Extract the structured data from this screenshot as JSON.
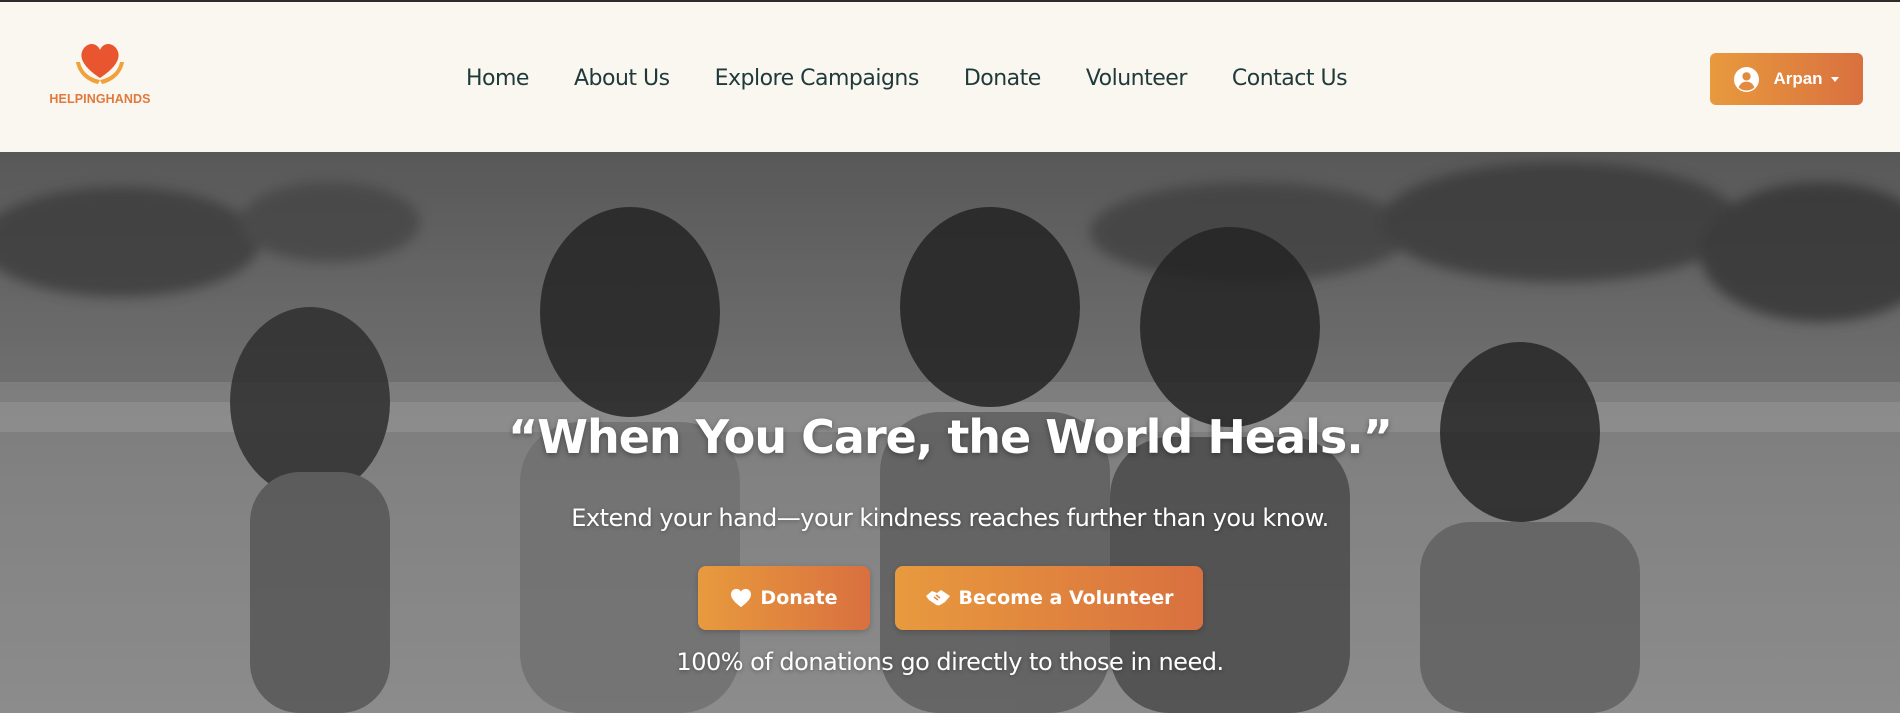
{
  "brand": {
    "name": "HELPINGHANDS",
    "logo_icon": "heart-hands-icon",
    "color": "#e07a3c"
  },
  "nav": {
    "items": [
      {
        "label": "Home"
      },
      {
        "label": "About Us"
      },
      {
        "label": "Explore Campaigns"
      },
      {
        "label": "Donate"
      },
      {
        "label": "Volunteer"
      },
      {
        "label": "Contact Us"
      }
    ]
  },
  "user": {
    "name": "Arpan",
    "icon": "user-circle-icon"
  },
  "hero": {
    "title": "“When You Care, the World Heals.”",
    "subtitle": "Extend your hand—your kindness reaches further than you know.",
    "donate_label": "Donate",
    "volunteer_label": "Become a Volunteer",
    "note": "100% of donations go directly to those in need."
  },
  "colors": {
    "accent_start": "#e89a3e",
    "accent_end": "#d9703f",
    "nav_text": "#1f3a3a",
    "header_bg": "#faf6f0"
  }
}
